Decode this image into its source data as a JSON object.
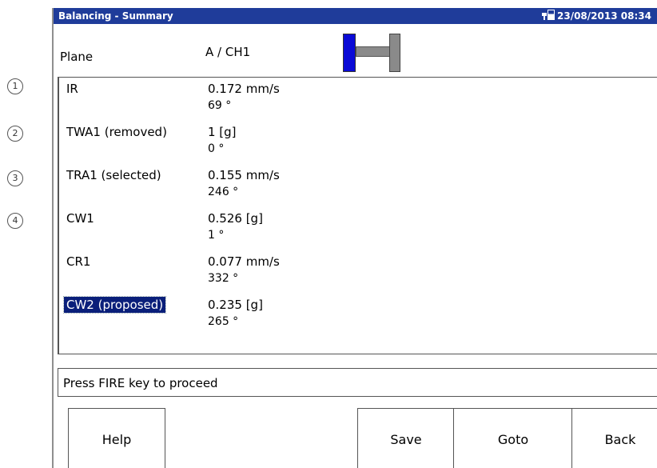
{
  "callouts": [
    "1",
    "2",
    "3",
    "4"
  ],
  "titlebar": {
    "title": "Balancing - Summary",
    "datetime": "23/08/2013 08:34"
  },
  "plane": {
    "label": "Plane",
    "value": "A / CH1"
  },
  "results": [
    {
      "name": "IR",
      "value": "0.172 mm/s",
      "angle": "69 °",
      "selected": false
    },
    {
      "name": "TWA1 (removed)",
      "value": "1 [g]",
      "angle": "0 °",
      "selected": false
    },
    {
      "name": "TRA1 (selected)",
      "value": "0.155 mm/s",
      "angle": "246 °",
      "selected": false
    },
    {
      "name": "CW1",
      "value": "0.526 [g]",
      "angle": "1 °",
      "selected": false
    },
    {
      "name": "CR1",
      "value": "0.077 mm/s",
      "angle": "332 °",
      "selected": false
    },
    {
      "name": "CW2 (proposed)",
      "value": "0.235 [g]",
      "angle": "265 °",
      "selected": true
    }
  ],
  "message": "Press FIRE key to proceed",
  "softkeys": {
    "help": "Help",
    "save": "Save",
    "goto": "Goto",
    "back": "Back"
  },
  "colors": {
    "titlebar": "#1f3c9a",
    "selection": "#0a1f7a",
    "rotor_active": "#0a0ad6",
    "rotor_inactive": "#8a8a8a"
  }
}
